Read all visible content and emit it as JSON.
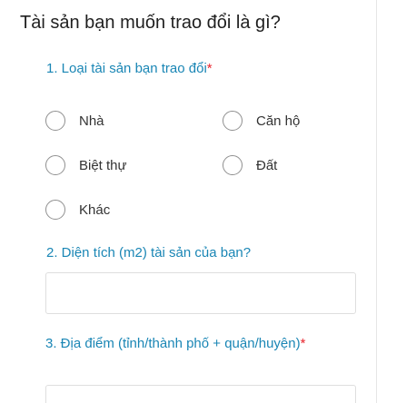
{
  "form": {
    "title": "Tài sản bạn muốn trao đổi là gì?",
    "questions": [
      {
        "number_label": "1. Loại tài sản bạn trao đổi",
        "required_mark": "*",
        "options": [
          "Nhà",
          "Căn hộ",
          "Biệt thự",
          "Đất",
          "Khác"
        ],
        "selected": null
      },
      {
        "number_label": "2. Diện tích (m2) tài sản của bạn?",
        "value": ""
      },
      {
        "number_label": "3. Địa điểm (tỉnh/thành phố + quận/huyện)",
        "required_mark": "*",
        "value": ""
      }
    ]
  },
  "colors": {
    "question_text": "#1a86b5",
    "required": "#e8252d",
    "title_text": "#1f1f1f",
    "radio_border": "#8f8f8f",
    "input_border": "#dedede"
  }
}
